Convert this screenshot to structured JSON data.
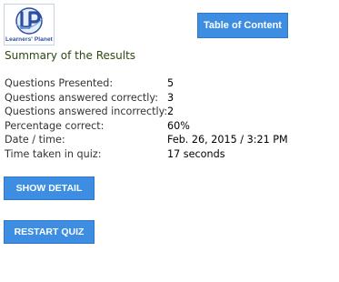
{
  "logo": {
    "monogram": "LP",
    "text": "Learners' Planet"
  },
  "header": {
    "toc_label": "Table of Content"
  },
  "summary": {
    "title": "Summary of the Results",
    "rows": [
      {
        "label": "Questions Presented:",
        "value": "5"
      },
      {
        "label": "Questions answered correctly:",
        "value": "3"
      },
      {
        "label": "Questions answered incorrectly:",
        "value": "2"
      },
      {
        "label": "Percentage correct:",
        "value": "60%"
      },
      {
        "label": "Date / time:",
        "value": "Feb. 26, 2015 / 3:21 PM"
      },
      {
        "label": "Time taken in quiz:",
        "value": "17 seconds"
      }
    ]
  },
  "actions": {
    "show_detail_label": "SHOW DETAIL",
    "restart_label": "RESTART QUIZ"
  },
  "colors": {
    "button_blue": "#3d8ee3",
    "title_green": "#2a4a10",
    "logo_blue": "#2a4f9e"
  }
}
